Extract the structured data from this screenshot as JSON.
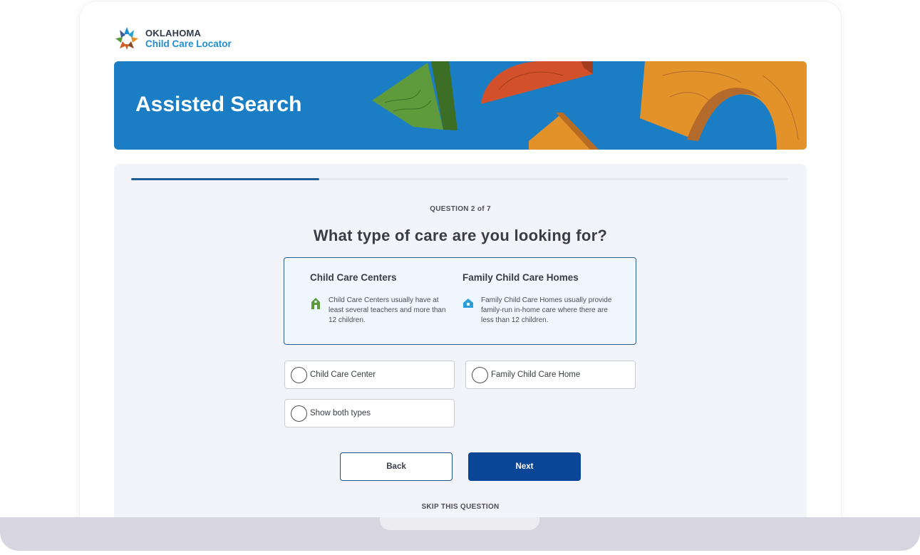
{
  "brand": {
    "line1": "OKLAHOMA",
    "line2": "Child Care Locator",
    "logo_icon": "oklahoma-star-logo"
  },
  "hero": {
    "title": "Assisted Search",
    "background": "#1b7ec4"
  },
  "progress": {
    "fraction": 0.286,
    "label": "QUESTION 2 of 7"
  },
  "question": {
    "title": "What type of care are you looking for?"
  },
  "info": {
    "center": {
      "heading": "Child Care Centers",
      "icon": "building-icon",
      "text": "Child Care Centers usually have at least several teachers and more than 12 children."
    },
    "home": {
      "heading": "Family Child Care Homes",
      "icon": "house-icon",
      "text": "Family Child Care Homes usually provide family-run in-home care where there are less than 12 children."
    }
  },
  "options": [
    {
      "label": "Child Care Center",
      "selected": false
    },
    {
      "label": "Family Child Care Home",
      "selected": false
    },
    {
      "label": "Show both types",
      "selected": false
    }
  ],
  "actions": {
    "back": "Back",
    "next": "Next",
    "skip": "SKIP THIS QUESTION"
  },
  "colors": {
    "accent": "#0a4596",
    "progress": "#1e5e97",
    "center_icon": "#5a9a3a",
    "home_icon": "#2a9fd8"
  }
}
